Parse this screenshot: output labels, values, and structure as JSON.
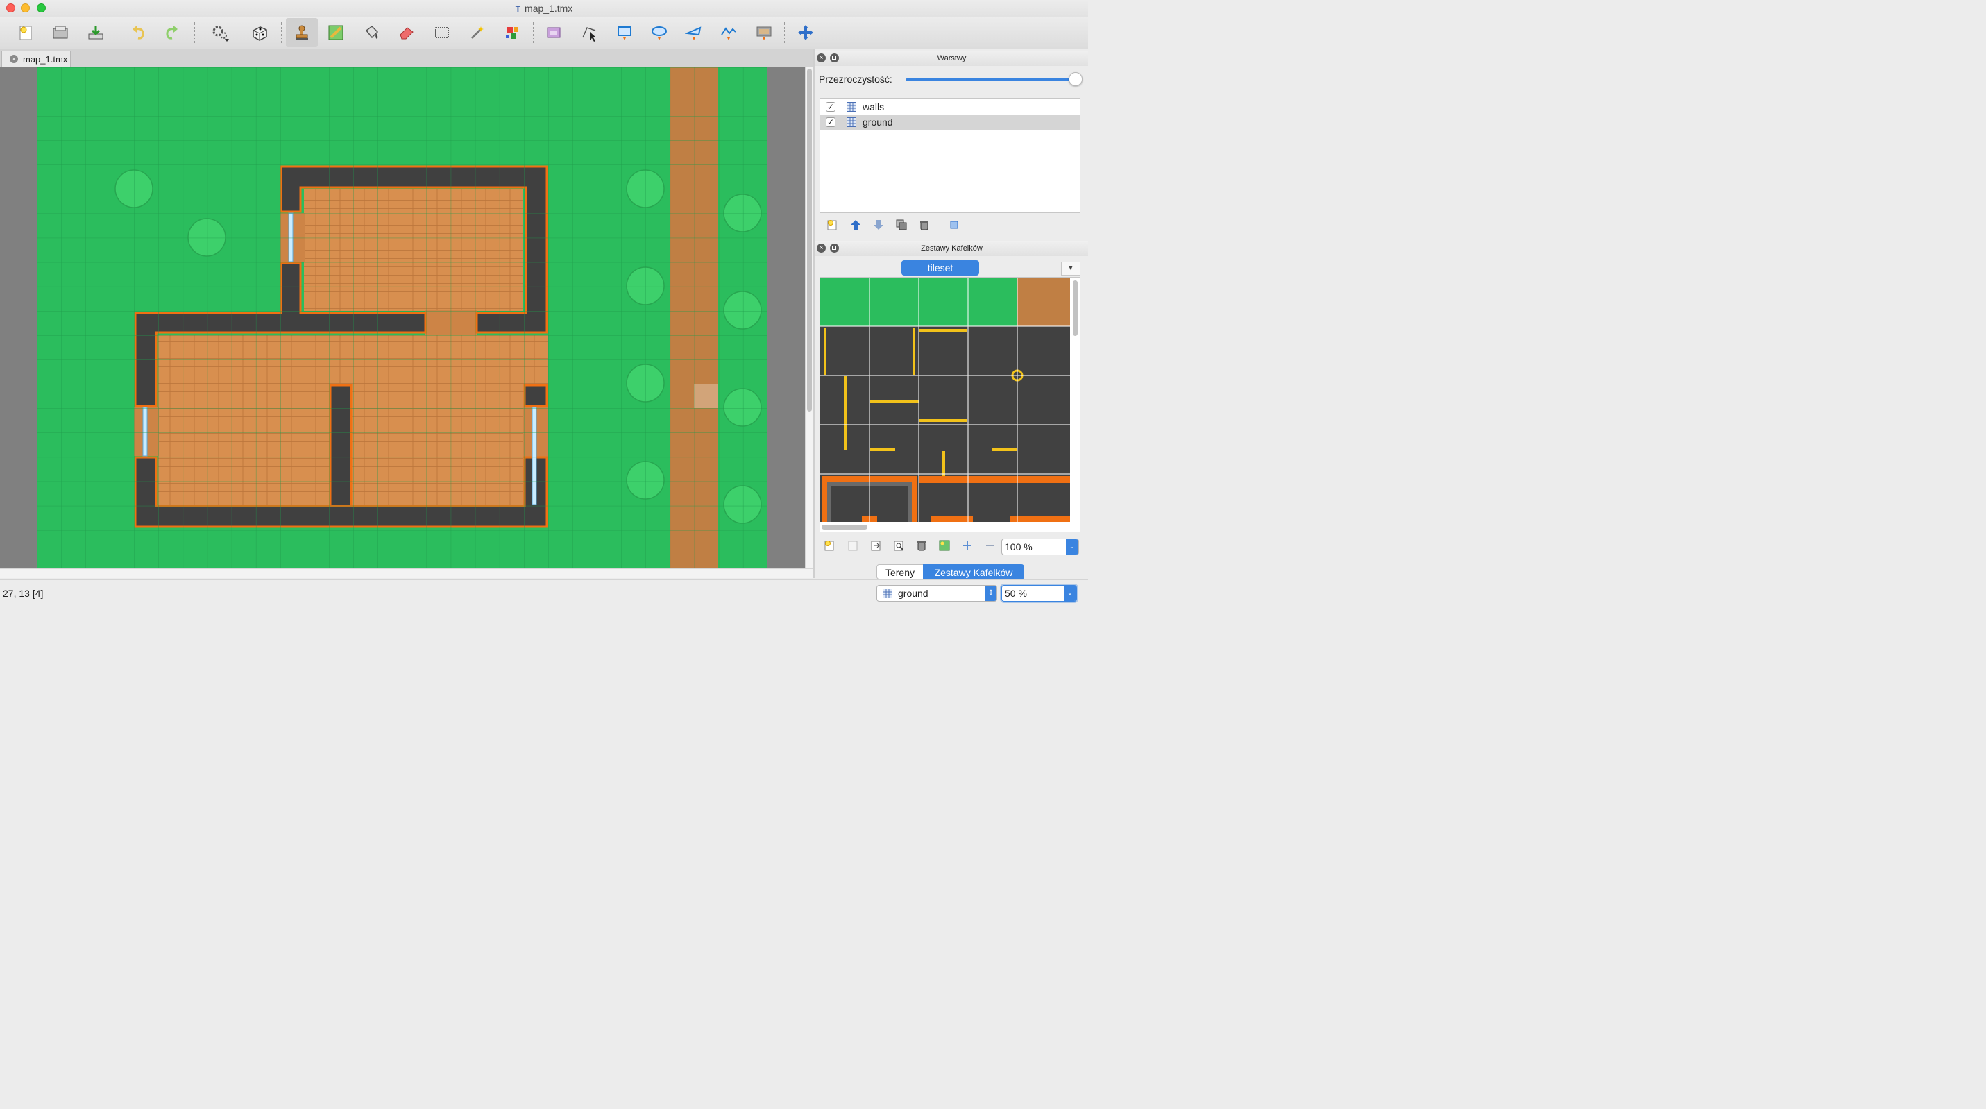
{
  "window": {
    "title": "map_1.tmx",
    "title_icon": "T"
  },
  "toolbar": {
    "buttons": [
      "new-map-icon",
      "open-map-icon",
      "save-map-icon",
      "undo-icon",
      "redo-icon",
      "command-icon",
      "random-mode-icon",
      "stamp-brush-icon",
      "terrain-brush-icon",
      "bucket-fill-icon",
      "eraser-icon",
      "rectangular-select-icon",
      "magic-wand-icon",
      "select-same-tile-icon",
      "insert-image-icon",
      "edit-polygons-icon",
      "insert-rectangle-icon",
      "insert-ellipse-icon",
      "insert-polygon-icon",
      "insert-polyline-icon",
      "insert-tile-icon",
      "move-icon"
    ]
  },
  "document": {
    "tab_label": "map_1.tmx"
  },
  "layers_panel": {
    "title": "Warstwy",
    "opacity_label": "Przezroczystość:",
    "opacity": 1.0,
    "layers": [
      {
        "name": "walls",
        "visible": true,
        "selected": false
      },
      {
        "name": "ground",
        "visible": true,
        "selected": true
      }
    ]
  },
  "tilesets_panel": {
    "title": "Zestawy Kafelków",
    "tileset_tab": "tileset",
    "zoom": "100 %"
  },
  "dock_tabs": {
    "terrain": "Tereny",
    "tilesets": "Zestawy Kafelków"
  },
  "status": {
    "coords": "27, 13 [4]",
    "current_layer": "ground",
    "zoom": "50 %"
  },
  "colors": {
    "grass": "#2bbd5d",
    "dirt": "#c07f44",
    "wood_floor": "#d88f4f",
    "wall": "#404040",
    "wall_outline": "#f07013",
    "accent": "#3a84e0"
  }
}
